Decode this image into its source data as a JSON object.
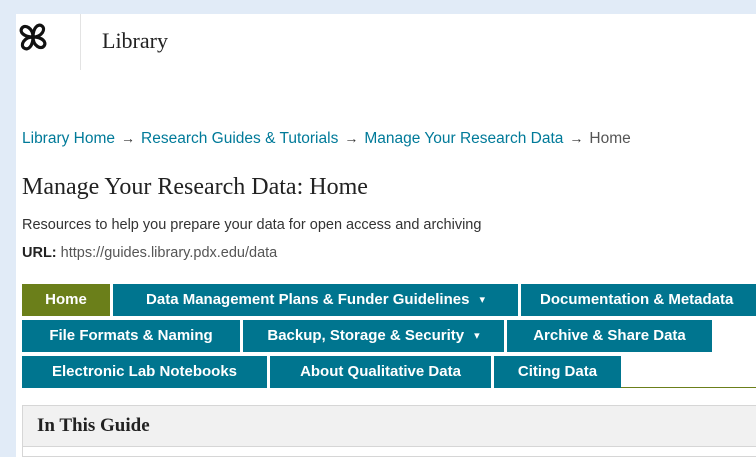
{
  "header": {
    "site_name": "Library",
    "logo_icon": "library-knot-logo-icon"
  },
  "breadcrumb": {
    "items": [
      "Library Home",
      "Research Guides & Tutorials",
      "Manage Your Research Data"
    ],
    "current": "Home",
    "separator": "→"
  },
  "guide": {
    "title": "Manage Your Research Data: Home",
    "description": "Resources to help you prepare your data for open access and archiving",
    "url_label": "URL:",
    "url": "https://guides.library.pdx.edu/data"
  },
  "tabs": {
    "row1": [
      {
        "label": "Home",
        "active": true
      },
      {
        "label": "Data Management Plans & Funder Guidelines",
        "dropdown": true
      },
      {
        "label": "Documentation & Metadata"
      }
    ],
    "row2": [
      {
        "label": "File Formats & Naming"
      },
      {
        "label": "Backup, Storage & Security",
        "dropdown": true
      },
      {
        "label": "Archive & Share Data"
      }
    ],
    "row3": [
      {
        "label": "Electronic Lab Notebooks"
      },
      {
        "label": "About Qualitative Data"
      },
      {
        "label": "Citing Data"
      }
    ],
    "caret": "▾"
  },
  "box": {
    "title": "In This Guide"
  },
  "colors": {
    "tab": "#00758f",
    "active_tab": "#6b7f1a",
    "link": "#007a99",
    "background": "#e1ebf7"
  }
}
